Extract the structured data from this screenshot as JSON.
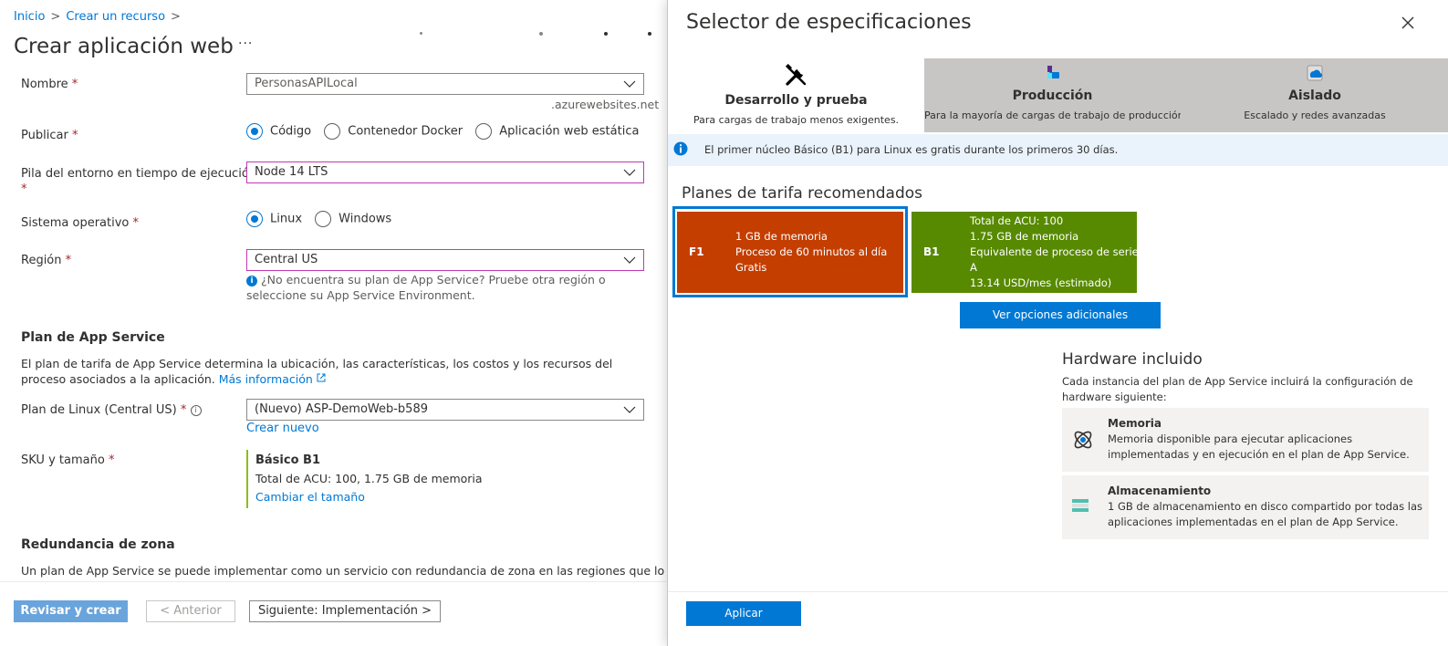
{
  "breadcrumb": {
    "home": "Inicio",
    "sep": ">",
    "create": "Crear un recurso",
    "sep2": ">"
  },
  "page": {
    "title": "Crear aplicación web",
    "more": "···"
  },
  "form": {
    "name_label": "Nombre",
    "name_value": "PersonasAPILocal",
    "name_suffix": ".azurewebsites.net",
    "publish_label": "Publicar",
    "publish_options": [
      "Código",
      "Contenedor Docker",
      "Aplicación web estática"
    ],
    "publish_selected": "Código",
    "runtime_label": "Pila del entorno en tiempo de ejecución",
    "runtime_value": "Node 14 LTS",
    "os_label": "Sistema operativo",
    "os_options": [
      "Linux",
      "Windows"
    ],
    "os_selected": "Linux",
    "region_label": "Región",
    "region_value": "Central US",
    "region_hint": "¿No encuentra su plan de App Service? Pruebe otra región o seleccione su App Service Environment.",
    "required_mark": "*"
  },
  "app_service": {
    "section_title": "Plan de App Service",
    "description": "El plan de tarifa de App Service determina la ubicación, las características, los costos y los recursos del proceso asociados a la aplicación.",
    "more_info": "Más información",
    "plan_label": "Plan de Linux (Central US)",
    "plan_value": "(Nuevo) ASP-DemoWeb-b589",
    "create_new": "Crear nuevo",
    "sku_label": "SKU y tamaño",
    "sku_name": "Básico B1",
    "sku_detail": "Total de ACU: 100, 1.75 GB de memoria",
    "sku_change": "Cambiar el tamaño"
  },
  "zone": {
    "section_title": "Redundancia de zona",
    "description": "Un plan de App Service se puede implementar como un servicio con redundancia de zona en las regiones que lo"
  },
  "left_footer": {
    "review": "Revisar y crear",
    "previous": "< Anterior",
    "next": "Siguiente: Implementación >"
  },
  "spec_picker": {
    "title": "Selector de especificaciones",
    "tabs": [
      {
        "name": "Desarrollo y prueba",
        "desc": "Para cargas de trabajo menos exigentes.",
        "icon": "tools-icon",
        "active": true
      },
      {
        "name": "Producción",
        "desc": "Para la mayoría de cargas de trabajo de producción",
        "icon": "production-icon",
        "active": false
      },
      {
        "name": "Aislado",
        "desc": "Escalado y redes avanzadas",
        "icon": "isolated-icon",
        "active": false
      }
    ],
    "banner": "El primer núcleo Básico (B1) para Linux es gratis durante los primeros 30 días.",
    "plans_title": "Planes de tarifa recomendados",
    "plans": [
      {
        "code": "F1",
        "lines": [
          "1 GB de memoria",
          "Proceso de 60 minutos al día",
          "Gratis"
        ],
        "color": "#c43e00",
        "selected": true
      },
      {
        "code": "B1",
        "lines": [
          "Total de ACU: 100",
          "1.75 GB de memoria",
          "Equivalente de proceso de serie",
          "A",
          "13.14 USD/mes (estimado)"
        ],
        "color": "#578a00",
        "selected": false
      }
    ],
    "more_options": "Ver opciones adicionales",
    "hardware_title": "Hardware incluido",
    "hardware_desc": "Cada instancia del plan de App Service incluirá la configuración de hardware siguiente:",
    "hardware": [
      {
        "name": "Memoria",
        "desc": "Memoria disponible para ejecutar aplicaciones implementadas y en ejecución en el plan de App Service.",
        "icon": "memory-icon"
      },
      {
        "name": "Almacenamiento",
        "desc": "1 GB de almacenamiento en disco compartido por todas las aplicaciones implementadas en el plan de App Service.",
        "icon": "storage-icon"
      }
    ],
    "apply": "Aplicar"
  },
  "colors": {
    "accent": "#0078d4",
    "required": "#a4262c",
    "f1": "#c43e00",
    "b1": "#578a00"
  }
}
